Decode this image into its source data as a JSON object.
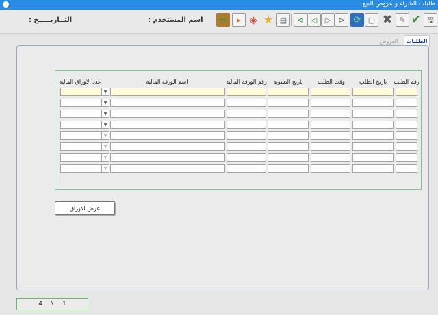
{
  "window": {
    "title": "طلبات الشراء و عروض البيع"
  },
  "header": {
    "user_label": "اسم المستخدم :",
    "date_label": "التــاريـــــخ :"
  },
  "toolbar": {
    "buttons": [
      {
        "name": "save-icon",
        "glyph": "🖫"
      },
      {
        "name": "check-icon",
        "glyph": "✔"
      },
      {
        "name": "edit-icon",
        "glyph": "✎"
      },
      {
        "name": "delete-icon",
        "glyph": "✖"
      },
      {
        "name": "new-document-icon",
        "glyph": "▢"
      },
      {
        "name": "refresh-icon",
        "glyph": "⟳"
      },
      {
        "name": "last-record-icon",
        "glyph": "⊳"
      },
      {
        "name": "next-record-icon",
        "glyph": "▷"
      },
      {
        "name": "previous-record-icon",
        "glyph": "◁"
      },
      {
        "name": "first-record-icon",
        "glyph": "⊲"
      },
      {
        "name": "calculator-icon",
        "glyph": "▤"
      },
      {
        "name": "favorite-star-icon",
        "glyph": "★"
      },
      {
        "name": "attachment-icon",
        "glyph": "◈"
      },
      {
        "name": "print-icon",
        "glyph": "▸"
      },
      {
        "name": "exit-icon",
        "glyph": "⇚"
      }
    ]
  },
  "tabs": [
    {
      "label": "الطلبات",
      "active": true
    },
    {
      "label": "العروض",
      "active": false
    }
  ],
  "grid": {
    "headers": {
      "order_no": "رقم الطلب",
      "order_date": "تاريخ الطلب",
      "order_time": "وقت الطلب",
      "settlement_date": "تاريخ التسوية",
      "security_no": "رقم الورقة المالية",
      "security_name": "اسم الورقة المالية",
      "quantity": "عدد الاوراق المالية"
    },
    "row_count": 8
  },
  "buttons": {
    "show_securities": "عرض الاوراق"
  },
  "pager": {
    "current": "1",
    "separator": "\\",
    "total": "4"
  },
  "colors": {
    "titlebar": "#2a8be3",
    "grid_border": "#7dc690",
    "highlight_row": "#fefcd7"
  }
}
